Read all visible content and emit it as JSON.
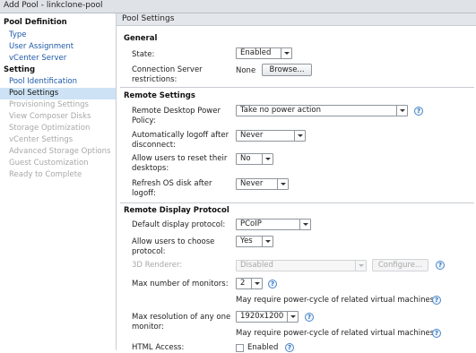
{
  "window": {
    "title": "Add Pool - linkclone-pool"
  },
  "sidebar": {
    "pool_definition_heading": "Pool Definition",
    "pool_definition_items": [
      "Type",
      "User Assignment",
      "vCenter Server"
    ],
    "setting_heading": "Setting",
    "setting_items": [
      {
        "label": "Pool Identification",
        "state": "link"
      },
      {
        "label": "Pool Settings",
        "state": "selected"
      },
      {
        "label": "Provisioning Settings",
        "state": "disabled"
      },
      {
        "label": "View Composer Disks",
        "state": "disabled"
      },
      {
        "label": "Storage Optimization",
        "state": "disabled"
      },
      {
        "label": "vCenter Settings",
        "state": "disabled"
      },
      {
        "label": "Advanced Storage Options",
        "state": "disabled"
      },
      {
        "label": "Guest Customization",
        "state": "disabled"
      },
      {
        "label": "Ready to Complete",
        "state": "disabled"
      }
    ]
  },
  "main": {
    "header": "Pool Settings",
    "general": {
      "heading": "General",
      "state_label": "State:",
      "state_value": "Enabled",
      "cs_restrictions_label": "Connection Server restrictions:",
      "cs_restrictions_value": "None",
      "browse_button": "Browse..."
    },
    "remote_settings": {
      "heading": "Remote Settings",
      "rd_power_policy_label": "Remote Desktop Power Policy:",
      "rd_power_policy_value": "Take no power action",
      "auto_logoff_label": "Automatically logoff after disconnect:",
      "auto_logoff_value": "Never",
      "allow_reset_label": "Allow users to reset their desktops:",
      "allow_reset_value": "No",
      "refresh_os_label": "Refresh OS disk after logoff:",
      "refresh_os_value": "Never"
    },
    "remote_display": {
      "heading": "Remote Display Protocol",
      "default_protocol_label": "Default display protocol:",
      "default_protocol_value": "PCoIP",
      "allow_choose_label": "Allow users to choose protocol:",
      "allow_choose_value": "Yes",
      "renderer_label": "3D Renderer:",
      "renderer_value": "Disabled",
      "configure_button": "Configure...",
      "max_monitors_label": "Max number of monitors:",
      "max_monitors_value": "2",
      "power_cycle_note_1": "May require power-cycle of related virtual machines",
      "max_resolution_label": "Max resolution of any one monitor:",
      "max_resolution_value": "1920x1200",
      "power_cycle_note_2": "May require power-cycle of related virtual machines",
      "html_access_label": "HTML Access:",
      "html_access_checkbox_label": "Enabled"
    }
  },
  "icons": {
    "help": "help-icon",
    "dropdown": "chevron-down-icon"
  },
  "colors": {
    "link": "#1e5aa8",
    "selected_bg": "#cde3f5",
    "disabled_text": "#a8a8a8",
    "help_icon": "#2a6bb8"
  }
}
